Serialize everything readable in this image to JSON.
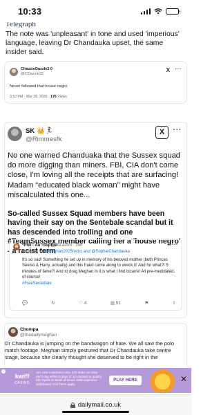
{
  "status_bar": {
    "time": "10:33",
    "battery_level": 0.75
  },
  "article": {
    "cut_headline": "Telegraph",
    "paragraph_1": "The note was 'unpleasant' in tone and used 'imperious' language, leaving Dr Chandauka upset, the same insider said."
  },
  "tweet_1": {
    "name": "ChazzieDazzle2.0",
    "handle": "@CDazzie22",
    "body": "Never followed that house negro",
    "meta_prefix": "3:52 PM · Mar 26, 2025 · ",
    "views_count": "176",
    "views_label": " Views",
    "x_icon": "X"
  },
  "tweet_2": {
    "name_emoji": "SK 👑🏃‍♀️",
    "handle": "@Rimmesfk",
    "body": "No one warned Chanduaka that the Sussex squad do more digging than miners. FBI, CIA don't come close, I'm loving all the receipts that are surfacing! Madam “educated black woman” might have miscalculated this one...",
    "x_icon": "X"
  },
  "caption": "So-called Sussex Squad members have been having their say on the Sentebale scandal but it has descended into trolling and one #TeamSussex member calling her a 'house negro' - a racist term",
  "reply": {
    "name": "*Phil - Au -Sophie'",
    "handle": "@JoLassm · 16h",
    "reply_prefix": "Replying to ",
    "reply_targets": "@Meghan2025rocks and @SophieChandauka",
    "body": "It's so sad! Something he set up in memory of his beloved mother (both Princes Seeiso & Harry, actually) and this fraud came along to wreck it! And for what?! 5 minutes of fame?! And to drag Meghan in it is what I find bizarre! All pre-medidated, of course!",
    "hashtag": "#FreeSentebale",
    "actions": {
      "comment": "💬",
      "retweet": "↻",
      "like_count": "4",
      "views_count": "51",
      "bookmark": "⚑",
      "share": "⇧"
    }
  },
  "tweet_3": {
    "name": "Chompa",
    "handle": "@thedallymeghan",
    "body": "Dr Chandauka is jumping on the bandwagon of hate. We all saw the polo match footage. Meghan simply gestured that Dr Chandauka take centre stage, because she clearly thought she deserved to be right in the"
  },
  "ad": {
    "brand": "kwiff",
    "brand_sub": "CASINO",
    "text": "18+ new customers only. £20 stake on slots each day within 5 days of 1st deposit to qualify. £10 Spins on Book of Dead. £250 total max withdrawal. Full T&Cs apply.",
    "cta": "PLAY HERE",
    "close": "✕",
    "info": "i"
  },
  "url_bar": {
    "domain": "dailymail.co.uk"
  }
}
